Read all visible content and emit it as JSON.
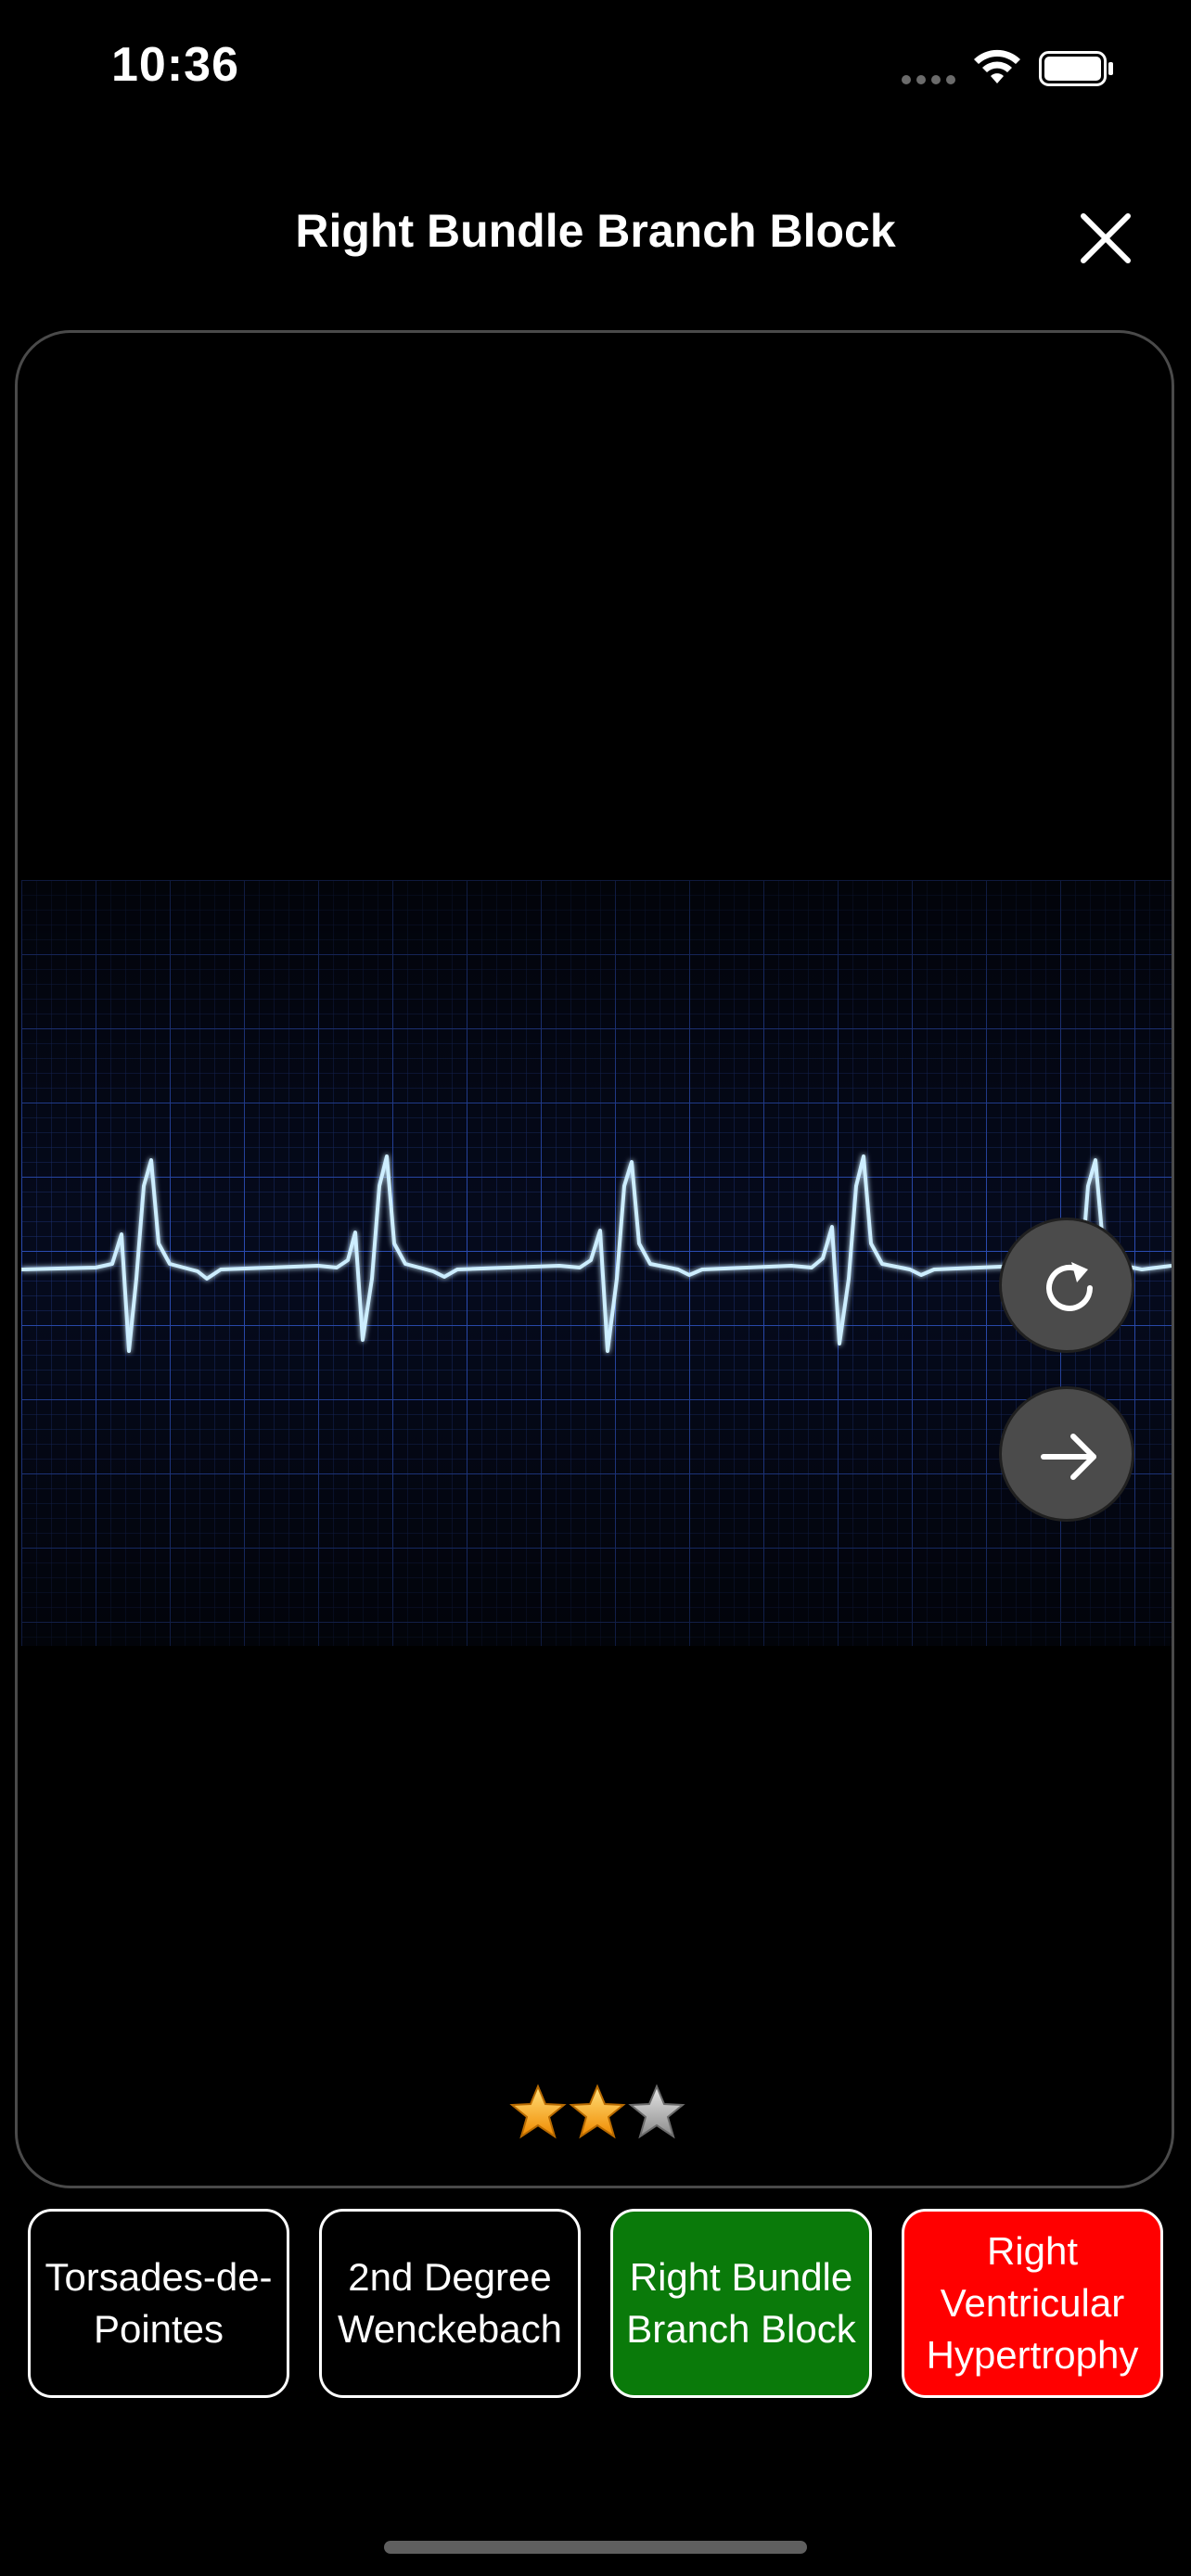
{
  "status_bar": {
    "time": "10:36",
    "wifi_icon": "wifi-icon",
    "battery_icon": "battery-full-icon"
  },
  "header": {
    "title": "Right Bundle Branch Block",
    "close_icon": "close-icon"
  },
  "card": {
    "strip_icon": "ecg-rhythm-strip",
    "replay_icon": "replay-icon",
    "next_icon": "arrow-right-icon",
    "rating": {
      "filled": 2,
      "total": 3
    }
  },
  "options": [
    {
      "label": "Torsades-de-Pointes",
      "state": "neutral"
    },
    {
      "label": "2nd Degree Wenckebach",
      "state": "neutral"
    },
    {
      "label": "Right Bundle Branch Block",
      "state": "correct"
    },
    {
      "label": "Right Ventricular Hypertrophy",
      "state": "wrong"
    }
  ],
  "colors": {
    "correct": "#0a7a0a",
    "wrong": "#ff0000",
    "grid": "#1f3b8a",
    "trace": "#cdeeff"
  }
}
